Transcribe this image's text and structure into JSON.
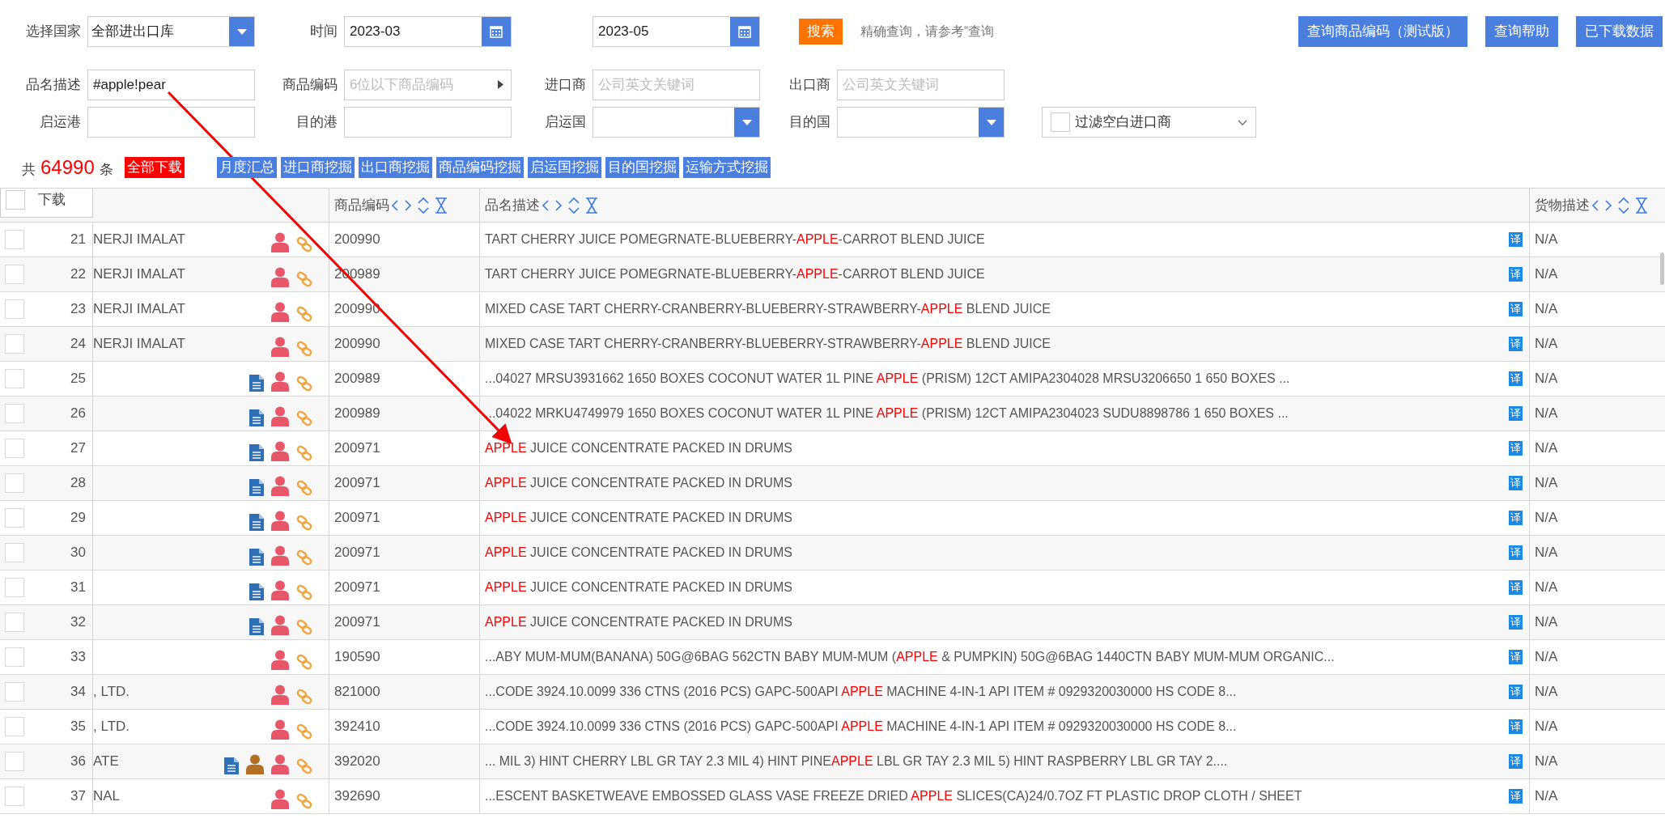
{
  "filters": {
    "country": {
      "label": "选择国家",
      "value": "全部进出口库"
    },
    "period": {
      "label": "时间",
      "from": "2023-03",
      "to": "2023-05"
    },
    "search_button": "搜索",
    "hint": "精确查询，请参考“查询",
    "header_buttons": [
      "查询商品编码（测试版）",
      "查询帮助",
      "已下载数据"
    ],
    "fields": [
      {
        "label": "品名描述",
        "kind": "text",
        "value": "#apple!pear"
      },
      {
        "label": "商品编码",
        "kind": "picker",
        "placeholder": "6位以下商品编码"
      },
      {
        "label": "进口商",
        "kind": "text",
        "placeholder": "公司英文关键词"
      },
      {
        "label": "出口商",
        "kind": "text",
        "placeholder": "公司英文关键词"
      },
      {
        "label": "启运港",
        "kind": "text"
      },
      {
        "label": "目的港",
        "kind": "text"
      },
      {
        "label": "启运国",
        "kind": "select"
      },
      {
        "label": "目的国",
        "kind": "select"
      }
    ],
    "filter_blank_importers": {
      "label": "过滤空白进口商",
      "checked": false
    }
  },
  "results": {
    "prefix": "共",
    "count": "64990",
    "suffix": "条",
    "download_all": "全部下载",
    "tools": [
      "月度汇总",
      "进口商挖掘",
      "出口商挖掘",
      "商品编码挖掘",
      "启运国挖掘",
      "目的国挖掘",
      "运输方式挖掘"
    ]
  },
  "table": {
    "download_label": "下载",
    "select_all": false,
    "columns": [
      {
        "label": "商品编码"
      },
      {
        "label": "品名描述"
      },
      {
        "label": "货物描述"
      }
    ],
    "rows": [
      {
        "no": "21",
        "checked": false,
        "company": "NERJI IMALAT",
        "document": false,
        "contact": false,
        "hs_code": "200990",
        "description": [
          {
            "text": "TART CHERRY JUICE POMEGRNATE-BLUEBERRY-",
            "match": false
          },
          {
            "text": "APPLE",
            "match": true
          },
          {
            "text": "-CARROT BLEND JUICE",
            "match": false
          }
        ],
        "translate": "译",
        "cargo": "N/A"
      },
      {
        "no": "22",
        "checked": false,
        "company": "NERJI IMALAT",
        "document": false,
        "contact": false,
        "hs_code": "200989",
        "description": [
          {
            "text": "TART CHERRY JUICE POMEGRNATE-BLUEBERRY-",
            "match": false
          },
          {
            "text": "APPLE",
            "match": true
          },
          {
            "text": "-CARROT BLEND JUICE",
            "match": false
          }
        ],
        "translate": "译",
        "cargo": "N/A"
      },
      {
        "no": "23",
        "checked": false,
        "company": "NERJI IMALAT",
        "document": false,
        "contact": false,
        "hs_code": "200990",
        "description": [
          {
            "text": "MIXED CASE TART CHERRY-CRANBERRY-BLUEBERRY-STRAWBERRY-",
            "match": false
          },
          {
            "text": "APPLE",
            "match": true
          },
          {
            "text": " BLEND JUICE",
            "match": false
          }
        ],
        "translate": "译",
        "cargo": "N/A"
      },
      {
        "no": "24",
        "checked": false,
        "company": "NERJI IMALAT",
        "document": false,
        "contact": false,
        "hs_code": "200990",
        "description": [
          {
            "text": "MIXED CASE TART CHERRY-CRANBERRY-BLUEBERRY-STRAWBERRY-",
            "match": false
          },
          {
            "text": "APPLE",
            "match": true
          },
          {
            "text": " BLEND JUICE",
            "match": false
          }
        ],
        "translate": "译",
        "cargo": "N/A"
      },
      {
        "no": "25",
        "checked": false,
        "document": true,
        "contact": false,
        "hs_code": "200989",
        "description": [
          {
            "text": "...04027 MRSU3931662 1650 BOXES COCONUT WATER 1L PINE ",
            "match": false
          },
          {
            "text": "APPLE",
            "match": true
          },
          {
            "text": " (PRISM) 12CT AMIPA2304028 MRSU3206650 1 650 BOXES ...",
            "match": false
          }
        ],
        "translate": "译",
        "cargo": "N/A"
      },
      {
        "no": "26",
        "checked": false,
        "document": true,
        "contact": false,
        "hs_code": "200989",
        "description": [
          {
            "text": "...04022 MRKU4749979 1650 BOXES COCONUT WATER 1L PINE ",
            "match": false
          },
          {
            "text": "APPLE",
            "match": true
          },
          {
            "text": " (PRISM) 12CT AMIPA2304023 SUDU8898786 1 650 BOXES ...",
            "match": false
          }
        ],
        "translate": "译",
        "cargo": "N/A"
      },
      {
        "no": "27",
        "checked": false,
        "document": true,
        "contact": false,
        "hs_code": "200971",
        "description": [
          {
            "text": "APPLE",
            "match": true
          },
          {
            "text": " JUICE CONCENTRATE PACKED IN DRUMS",
            "match": false
          }
        ],
        "translate": "译",
        "cargo": "N/A"
      },
      {
        "no": "28",
        "checked": false,
        "document": true,
        "contact": false,
        "hs_code": "200971",
        "description": [
          {
            "text": "APPLE",
            "match": true
          },
          {
            "text": " JUICE CONCENTRATE PACKED IN DRUMS",
            "match": false
          }
        ],
        "translate": "译",
        "cargo": "N/A"
      },
      {
        "no": "29",
        "checked": false,
        "document": true,
        "contact": false,
        "hs_code": "200971",
        "description": [
          {
            "text": "APPLE",
            "match": true
          },
          {
            "text": " JUICE CONCENTRATE PACKED IN DRUMS",
            "match": false
          }
        ],
        "translate": "译",
        "cargo": "N/A"
      },
      {
        "no": "30",
        "checked": false,
        "document": true,
        "contact": false,
        "hs_code": "200971",
        "description": [
          {
            "text": "APPLE",
            "match": true
          },
          {
            "text": " JUICE CONCENTRATE PACKED IN DRUMS",
            "match": false
          }
        ],
        "translate": "译",
        "cargo": "N/A"
      },
      {
        "no": "31",
        "checked": false,
        "document": true,
        "contact": false,
        "hs_code": "200971",
        "description": [
          {
            "text": "APPLE",
            "match": true
          },
          {
            "text": " JUICE CONCENTRATE PACKED IN DRUMS",
            "match": false
          }
        ],
        "translate": "译",
        "cargo": "N/A"
      },
      {
        "no": "32",
        "checked": false,
        "document": true,
        "contact": false,
        "hs_code": "200971",
        "description": [
          {
            "text": "APPLE",
            "match": true
          },
          {
            "text": " JUICE CONCENTRATE PACKED IN DRUMS",
            "match": false
          }
        ],
        "translate": "译",
        "cargo": "N/A"
      },
      {
        "no": "33",
        "checked": false,
        "document": false,
        "contact": false,
        "hs_code": "190590",
        "description": [
          {
            "text": "...ABY MUM-MUM(BANANA) 50G@6BAG 562CTN BABY MUM-MUM (",
            "match": false
          },
          {
            "text": "APPLE",
            "match": true
          },
          {
            "text": " & PUMPKIN) 50G@6BAG 1440CTN BABY MUM-MUM ORGANIC...",
            "match": false
          }
        ],
        "translate": "译",
        "cargo": "N/A"
      },
      {
        "no": "34",
        "checked": false,
        "company": ", LTD.",
        "document": false,
        "contact": false,
        "hs_code": "821000",
        "description": [
          {
            "text": "...CODE 3924.10.0099 336 CTNS (2016 PCS) GAPC-500API ",
            "match": false
          },
          {
            "text": "APPLE",
            "match": true
          },
          {
            "text": " MACHINE 4-IN-1 API ITEM # 0929320030000 HS CODE 8...",
            "match": false
          }
        ],
        "translate": "译",
        "cargo": "N/A"
      },
      {
        "no": "35",
        "checked": false,
        "company": ", LTD.",
        "document": false,
        "contact": false,
        "hs_code": "392410",
        "description": [
          {
            "text": "...CODE 3924.10.0099 336 CTNS (2016 PCS) GAPC-500API ",
            "match": false
          },
          {
            "text": "APPLE",
            "match": true
          },
          {
            "text": " MACHINE 4-IN-1 API ITEM # 0929320030000 HS CODE 8...",
            "match": false
          }
        ],
        "translate": "译",
        "cargo": "N/A"
      },
      {
        "no": "36",
        "checked": false,
        "company": "ATE",
        "document": true,
        "contact": true,
        "hs_code": "392020",
        "description": [
          {
            "text": "... MIL 3) HINT CHERRY LBL GR TAY 2.3 MIL 4) HINT PINE",
            "match": false
          },
          {
            "text": "APPLE",
            "match": true
          },
          {
            "text": " LBL GR TAY 2.3 MIL 5) HINT RASPBERRY LBL GR TAY 2....",
            "match": false
          }
        ],
        "translate": "译",
        "cargo": "N/A"
      },
      {
        "no": "37",
        "checked": false,
        "company": "NAL",
        "document": false,
        "contact": false,
        "hs_code": "392690",
        "description": [
          {
            "text": "...ESCENT BASKETWEAVE EMBOSSED GLASS VASE FREEZE DRIED ",
            "match": false
          },
          {
            "text": "APPLE",
            "match": true
          },
          {
            "text": " SLICES(CA)24/0.7OZ FT PLASTIC DROP CLOTH / SHEET",
            "match": false
          }
        ],
        "translate": "译",
        "cargo": "N/A"
      }
    ]
  }
}
